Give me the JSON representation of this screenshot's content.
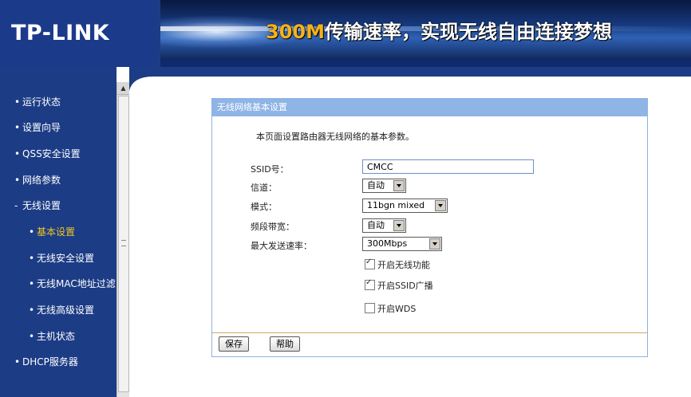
{
  "header": {
    "logo": "TP-LINK",
    "slogan_accent": "300M",
    "slogan_text": "传输速率，实现无线自由连接梦想"
  },
  "sidebar": {
    "items": [
      {
        "label": "运行状态",
        "level": 1
      },
      {
        "label": "设置向导",
        "level": 1
      },
      {
        "label": "QSS安全设置",
        "level": 1
      },
      {
        "label": "网络参数",
        "level": 1
      },
      {
        "label": "无线设置",
        "level": 1,
        "expanded": true
      },
      {
        "label": "基本设置",
        "level": 2,
        "active": true
      },
      {
        "label": "无线安全设置",
        "level": 2
      },
      {
        "label": "无线MAC地址过滤",
        "level": 2
      },
      {
        "label": "无线高级设置",
        "level": 2
      },
      {
        "label": "主机状态",
        "level": 2
      },
      {
        "label": "DHCP服务器",
        "level": 1
      }
    ],
    "bullet": "•",
    "expanded_bullet": "-"
  },
  "panel": {
    "title": "无线网络基本设置",
    "description": "本页面设置路由器无线网络的基本参数。",
    "fields": {
      "ssid": {
        "label": "SSID号：",
        "value": "CMCC"
      },
      "channel": {
        "label": "信道：",
        "value": "自动"
      },
      "mode": {
        "label": "模式：",
        "value": "11bgn mixed"
      },
      "bandwidth": {
        "label": "频段带宽：",
        "value": "自动"
      },
      "max_rate": {
        "label": "最大发送速率：",
        "value": "300Mbps"
      }
    },
    "checkboxes": [
      {
        "label": "开启无线功能",
        "checked": true
      },
      {
        "label": "开启SSID广播",
        "checked": true
      },
      {
        "label": "开启WDS",
        "checked": false
      }
    ],
    "buttons": {
      "save": "保存",
      "help": "帮助"
    }
  },
  "colors": {
    "sidebar_bg": "#1c3c85",
    "panel_title_bg": "#8fb4e6",
    "active_nav": "#f3c623",
    "slogan_accent": "#f4b21a"
  }
}
